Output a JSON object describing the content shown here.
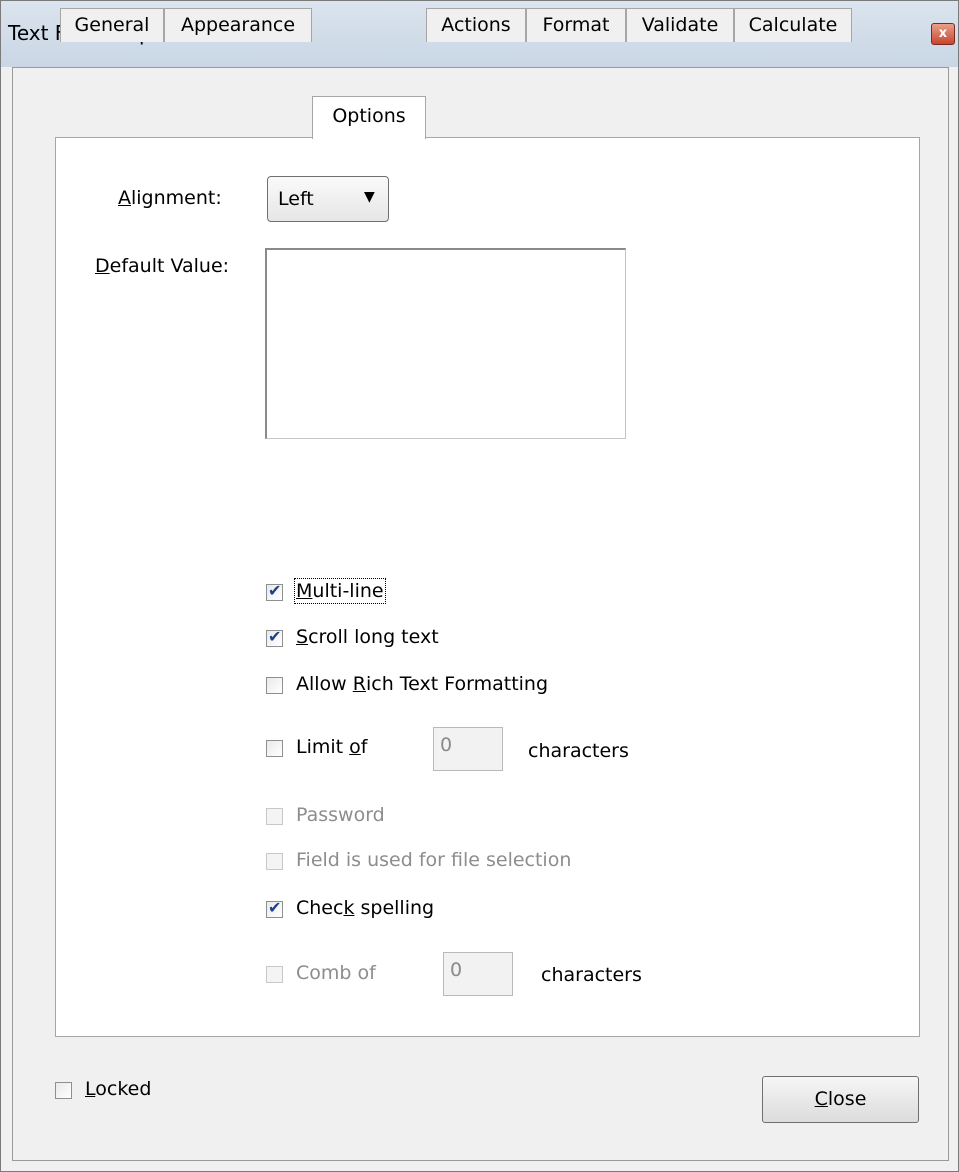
{
  "window": {
    "title": "Text Field Properties",
    "close_glyph": "x"
  },
  "tabs": [
    {
      "label": "General"
    },
    {
      "label": "Appearance"
    },
    {
      "label": "Options"
    },
    {
      "label": "Actions"
    },
    {
      "label": "Format"
    },
    {
      "label": "Validate"
    },
    {
      "label": "Calculate"
    }
  ],
  "active_tab": "Options",
  "options": {
    "alignment": {
      "label_key": "A",
      "label_rest": "lignment:",
      "value": "Left",
      "arrow": "▼"
    },
    "default_value": {
      "label_key": "D",
      "label_rest": "efault Value:",
      "value": ""
    },
    "multiline": {
      "key": "M",
      "rest": "ulti-line",
      "checked": true
    },
    "scroll": {
      "key": "S",
      "rest": "croll long text",
      "checked": true
    },
    "rich_text": {
      "pre": "Allow ",
      "key": "R",
      "rest": "ich Text Formatting",
      "checked": false
    },
    "limit": {
      "pre": "Limit ",
      "key": "o",
      "rest": "f",
      "value": "0",
      "suffix": "characters",
      "checked": false
    },
    "password": {
      "label": "Password",
      "checked": false,
      "enabled": false
    },
    "file_selection": {
      "label": "Field is used for file selection",
      "checked": false,
      "enabled": false
    },
    "spelling": {
      "pre": "Chec",
      "key": "k",
      "rest": " spelling",
      "checked": true
    },
    "comb": {
      "label": "Comb of",
      "value": "0",
      "suffix": "characters",
      "checked": false,
      "enabled": false
    }
  },
  "footer": {
    "locked": {
      "key": "L",
      "rest": "ocked",
      "checked": false
    },
    "close": {
      "key": "C",
      "rest": "lose"
    }
  },
  "colors": {
    "titlebar": "#c9d6e4",
    "panel": "#ffffff",
    "background": "#f0f0f0",
    "check": "#1d3f8c"
  }
}
